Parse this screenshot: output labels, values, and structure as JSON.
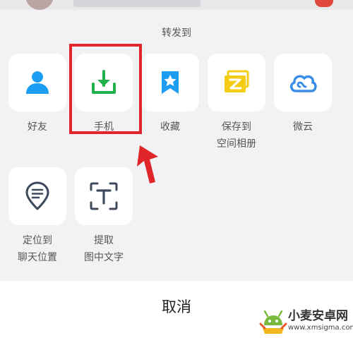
{
  "sheet": {
    "title": "转发到",
    "cancel_label": "取消"
  },
  "share_targets": [
    {
      "id": "friend",
      "label": "好友",
      "label_line2": "",
      "icon": "person-icon",
      "color": "#1a9df2"
    },
    {
      "id": "phone",
      "label": "手机",
      "label_line2": "",
      "icon": "download-icon",
      "color": "#22b14c",
      "highlighted": true
    },
    {
      "id": "favorite",
      "label": "收藏",
      "label_line2": "",
      "icon": "bookmark-star-icon",
      "color": "#1a9df2"
    },
    {
      "id": "album",
      "label": "保存到",
      "label_line2": "空间相册",
      "icon": "qzone-album-icon",
      "color": "#f5cc14"
    },
    {
      "id": "weiyun",
      "label": "微云",
      "label_line2": "",
      "icon": "cloud-icon",
      "color": "#3a8ee8"
    },
    {
      "id": "location",
      "label": "定位到",
      "label_line2": "聊天位置",
      "icon": "location-chat-icon",
      "color": "#3c4a5c"
    },
    {
      "id": "ocr",
      "label": "提取",
      "label_line2": "图中文字",
      "icon": "text-scan-icon",
      "color": "#3c4a5c"
    }
  ],
  "colors": {
    "highlight": "#e0262b",
    "background": "#f2f2f4"
  },
  "watermark": {
    "title": "小麦安卓网",
    "url": "www.xmsigma.com"
  }
}
